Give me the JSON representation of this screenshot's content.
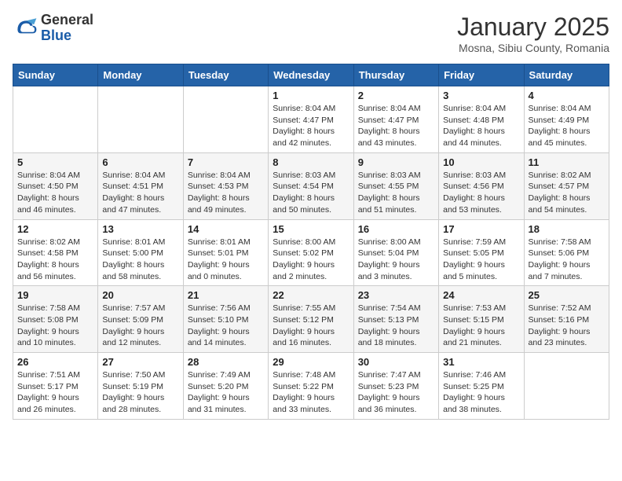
{
  "header": {
    "logo_general": "General",
    "logo_blue": "Blue",
    "month_title": "January 2025",
    "location": "Mosna, Sibiu County, Romania"
  },
  "days_of_week": [
    "Sunday",
    "Monday",
    "Tuesday",
    "Wednesday",
    "Thursday",
    "Friday",
    "Saturday"
  ],
  "weeks": [
    [
      {
        "day": "",
        "sunrise": "",
        "sunset": "",
        "daylight": ""
      },
      {
        "day": "",
        "sunrise": "",
        "sunset": "",
        "daylight": ""
      },
      {
        "day": "",
        "sunrise": "",
        "sunset": "",
        "daylight": ""
      },
      {
        "day": "1",
        "sunrise": "8:04 AM",
        "sunset": "4:47 PM",
        "daylight": "8 hours and 42 minutes."
      },
      {
        "day": "2",
        "sunrise": "8:04 AM",
        "sunset": "4:47 PM",
        "daylight": "8 hours and 43 minutes."
      },
      {
        "day": "3",
        "sunrise": "8:04 AM",
        "sunset": "4:48 PM",
        "daylight": "8 hours and 44 minutes."
      },
      {
        "day": "4",
        "sunrise": "8:04 AM",
        "sunset": "4:49 PM",
        "daylight": "8 hours and 45 minutes."
      }
    ],
    [
      {
        "day": "5",
        "sunrise": "8:04 AM",
        "sunset": "4:50 PM",
        "daylight": "8 hours and 46 minutes."
      },
      {
        "day": "6",
        "sunrise": "8:04 AM",
        "sunset": "4:51 PM",
        "daylight": "8 hours and 47 minutes."
      },
      {
        "day": "7",
        "sunrise": "8:04 AM",
        "sunset": "4:53 PM",
        "daylight": "8 hours and 49 minutes."
      },
      {
        "day": "8",
        "sunrise": "8:03 AM",
        "sunset": "4:54 PM",
        "daylight": "8 hours and 50 minutes."
      },
      {
        "day": "9",
        "sunrise": "8:03 AM",
        "sunset": "4:55 PM",
        "daylight": "8 hours and 51 minutes."
      },
      {
        "day": "10",
        "sunrise": "8:03 AM",
        "sunset": "4:56 PM",
        "daylight": "8 hours and 53 minutes."
      },
      {
        "day": "11",
        "sunrise": "8:02 AM",
        "sunset": "4:57 PM",
        "daylight": "8 hours and 54 minutes."
      }
    ],
    [
      {
        "day": "12",
        "sunrise": "8:02 AM",
        "sunset": "4:58 PM",
        "daylight": "8 hours and 56 minutes."
      },
      {
        "day": "13",
        "sunrise": "8:01 AM",
        "sunset": "5:00 PM",
        "daylight": "8 hours and 58 minutes."
      },
      {
        "day": "14",
        "sunrise": "8:01 AM",
        "sunset": "5:01 PM",
        "daylight": "9 hours and 0 minutes."
      },
      {
        "day": "15",
        "sunrise": "8:00 AM",
        "sunset": "5:02 PM",
        "daylight": "9 hours and 2 minutes."
      },
      {
        "day": "16",
        "sunrise": "8:00 AM",
        "sunset": "5:04 PM",
        "daylight": "9 hours and 3 minutes."
      },
      {
        "day": "17",
        "sunrise": "7:59 AM",
        "sunset": "5:05 PM",
        "daylight": "9 hours and 5 minutes."
      },
      {
        "day": "18",
        "sunrise": "7:58 AM",
        "sunset": "5:06 PM",
        "daylight": "9 hours and 7 minutes."
      }
    ],
    [
      {
        "day": "19",
        "sunrise": "7:58 AM",
        "sunset": "5:08 PM",
        "daylight": "9 hours and 10 minutes."
      },
      {
        "day": "20",
        "sunrise": "7:57 AM",
        "sunset": "5:09 PM",
        "daylight": "9 hours and 12 minutes."
      },
      {
        "day": "21",
        "sunrise": "7:56 AM",
        "sunset": "5:10 PM",
        "daylight": "9 hours and 14 minutes."
      },
      {
        "day": "22",
        "sunrise": "7:55 AM",
        "sunset": "5:12 PM",
        "daylight": "9 hours and 16 minutes."
      },
      {
        "day": "23",
        "sunrise": "7:54 AM",
        "sunset": "5:13 PM",
        "daylight": "9 hours and 18 minutes."
      },
      {
        "day": "24",
        "sunrise": "7:53 AM",
        "sunset": "5:15 PM",
        "daylight": "9 hours and 21 minutes."
      },
      {
        "day": "25",
        "sunrise": "7:52 AM",
        "sunset": "5:16 PM",
        "daylight": "9 hours and 23 minutes."
      }
    ],
    [
      {
        "day": "26",
        "sunrise": "7:51 AM",
        "sunset": "5:17 PM",
        "daylight": "9 hours and 26 minutes."
      },
      {
        "day": "27",
        "sunrise": "7:50 AM",
        "sunset": "5:19 PM",
        "daylight": "9 hours and 28 minutes."
      },
      {
        "day": "28",
        "sunrise": "7:49 AM",
        "sunset": "5:20 PM",
        "daylight": "9 hours and 31 minutes."
      },
      {
        "day": "29",
        "sunrise": "7:48 AM",
        "sunset": "5:22 PM",
        "daylight": "9 hours and 33 minutes."
      },
      {
        "day": "30",
        "sunrise": "7:47 AM",
        "sunset": "5:23 PM",
        "daylight": "9 hours and 36 minutes."
      },
      {
        "day": "31",
        "sunrise": "7:46 AM",
        "sunset": "5:25 PM",
        "daylight": "9 hours and 38 minutes."
      },
      {
        "day": "",
        "sunrise": "",
        "sunset": "",
        "daylight": ""
      }
    ]
  ]
}
